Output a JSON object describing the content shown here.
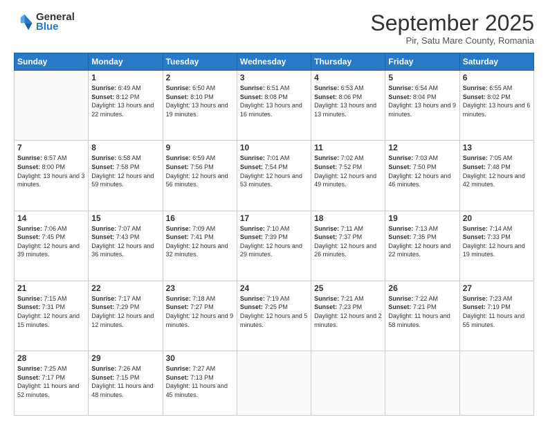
{
  "header": {
    "logo_general": "General",
    "logo_blue": "Blue",
    "month_title": "September 2025",
    "subtitle": "Pir, Satu Mare County, Romania"
  },
  "days_of_week": [
    "Sunday",
    "Monday",
    "Tuesday",
    "Wednesday",
    "Thursday",
    "Friday",
    "Saturday"
  ],
  "weeks": [
    [
      {
        "day": "",
        "info": ""
      },
      {
        "day": "1",
        "info": "Sunrise: 6:49 AM\nSunset: 8:12 PM\nDaylight: 13 hours and 22 minutes."
      },
      {
        "day": "2",
        "info": "Sunrise: 6:50 AM\nSunset: 8:10 PM\nDaylight: 13 hours and 19 minutes."
      },
      {
        "day": "3",
        "info": "Sunrise: 6:51 AM\nSunset: 8:08 PM\nDaylight: 13 hours and 16 minutes."
      },
      {
        "day": "4",
        "info": "Sunrise: 6:53 AM\nSunset: 8:06 PM\nDaylight: 13 hours and 13 minutes."
      },
      {
        "day": "5",
        "info": "Sunrise: 6:54 AM\nSunset: 8:04 PM\nDaylight: 13 hours and 9 minutes."
      },
      {
        "day": "6",
        "info": "Sunrise: 6:55 AM\nSunset: 8:02 PM\nDaylight: 13 hours and 6 minutes."
      }
    ],
    [
      {
        "day": "7",
        "info": "Sunrise: 6:57 AM\nSunset: 8:00 PM\nDaylight: 13 hours and 3 minutes."
      },
      {
        "day": "8",
        "info": "Sunrise: 6:58 AM\nSunset: 7:58 PM\nDaylight: 12 hours and 59 minutes."
      },
      {
        "day": "9",
        "info": "Sunrise: 6:59 AM\nSunset: 7:56 PM\nDaylight: 12 hours and 56 minutes."
      },
      {
        "day": "10",
        "info": "Sunrise: 7:01 AM\nSunset: 7:54 PM\nDaylight: 12 hours and 53 minutes."
      },
      {
        "day": "11",
        "info": "Sunrise: 7:02 AM\nSunset: 7:52 PM\nDaylight: 12 hours and 49 minutes."
      },
      {
        "day": "12",
        "info": "Sunrise: 7:03 AM\nSunset: 7:50 PM\nDaylight: 12 hours and 46 minutes."
      },
      {
        "day": "13",
        "info": "Sunrise: 7:05 AM\nSunset: 7:48 PM\nDaylight: 12 hours and 42 minutes."
      }
    ],
    [
      {
        "day": "14",
        "info": "Sunrise: 7:06 AM\nSunset: 7:45 PM\nDaylight: 12 hours and 39 minutes."
      },
      {
        "day": "15",
        "info": "Sunrise: 7:07 AM\nSunset: 7:43 PM\nDaylight: 12 hours and 36 minutes."
      },
      {
        "day": "16",
        "info": "Sunrise: 7:09 AM\nSunset: 7:41 PM\nDaylight: 12 hours and 32 minutes."
      },
      {
        "day": "17",
        "info": "Sunrise: 7:10 AM\nSunset: 7:39 PM\nDaylight: 12 hours and 29 minutes."
      },
      {
        "day": "18",
        "info": "Sunrise: 7:11 AM\nSunset: 7:37 PM\nDaylight: 12 hours and 26 minutes."
      },
      {
        "day": "19",
        "info": "Sunrise: 7:13 AM\nSunset: 7:35 PM\nDaylight: 12 hours and 22 minutes."
      },
      {
        "day": "20",
        "info": "Sunrise: 7:14 AM\nSunset: 7:33 PM\nDaylight: 12 hours and 19 minutes."
      }
    ],
    [
      {
        "day": "21",
        "info": "Sunrise: 7:15 AM\nSunset: 7:31 PM\nDaylight: 12 hours and 15 minutes."
      },
      {
        "day": "22",
        "info": "Sunrise: 7:17 AM\nSunset: 7:29 PM\nDaylight: 12 hours and 12 minutes."
      },
      {
        "day": "23",
        "info": "Sunrise: 7:18 AM\nSunset: 7:27 PM\nDaylight: 12 hours and 9 minutes."
      },
      {
        "day": "24",
        "info": "Sunrise: 7:19 AM\nSunset: 7:25 PM\nDaylight: 12 hours and 5 minutes."
      },
      {
        "day": "25",
        "info": "Sunrise: 7:21 AM\nSunset: 7:23 PM\nDaylight: 12 hours and 2 minutes."
      },
      {
        "day": "26",
        "info": "Sunrise: 7:22 AM\nSunset: 7:21 PM\nDaylight: 11 hours and 58 minutes."
      },
      {
        "day": "27",
        "info": "Sunrise: 7:23 AM\nSunset: 7:19 PM\nDaylight: 11 hours and 55 minutes."
      }
    ],
    [
      {
        "day": "28",
        "info": "Sunrise: 7:25 AM\nSunset: 7:17 PM\nDaylight: 11 hours and 52 minutes."
      },
      {
        "day": "29",
        "info": "Sunrise: 7:26 AM\nSunset: 7:15 PM\nDaylight: 11 hours and 48 minutes."
      },
      {
        "day": "30",
        "info": "Sunrise: 7:27 AM\nSunset: 7:13 PM\nDaylight: 11 hours and 45 minutes."
      },
      {
        "day": "",
        "info": ""
      },
      {
        "day": "",
        "info": ""
      },
      {
        "day": "",
        "info": ""
      },
      {
        "day": "",
        "info": ""
      }
    ]
  ]
}
